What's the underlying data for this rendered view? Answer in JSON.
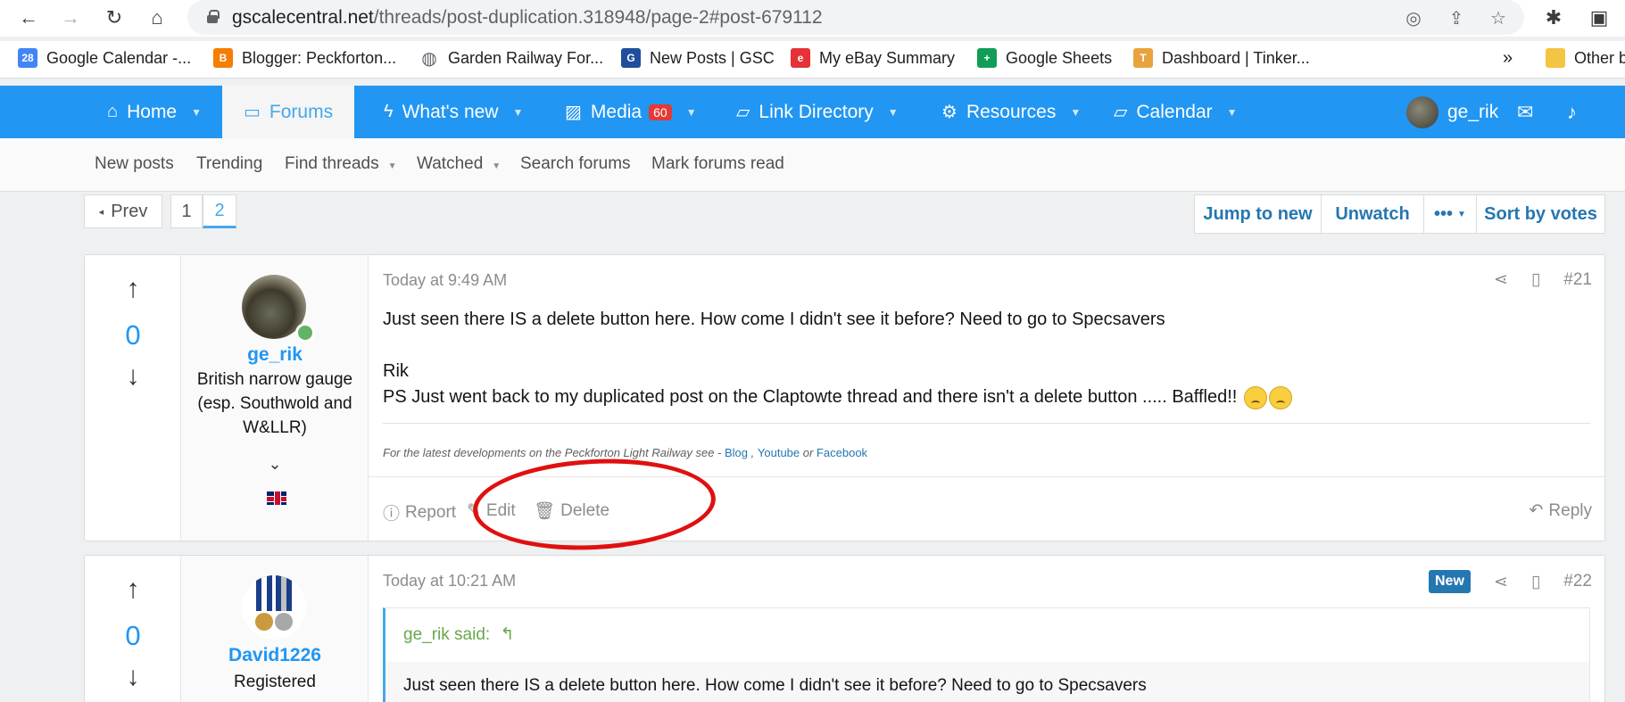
{
  "browser": {
    "url_host": "gscalecentral.net",
    "url_path": "/threads/post-duplication.318948/page-2#post-679112",
    "bookmarks": [
      {
        "label": "Google Calendar -...",
        "color": "#4285f4",
        "glyph": "28"
      },
      {
        "label": "Blogger: Peckforton...",
        "color": "#f57d00",
        "glyph": "B"
      },
      {
        "label": "Garden Railway For...",
        "color": "#5f6368",
        "glyph": "◍"
      },
      {
        "label": "New Posts | GSC",
        "color": "#1f4e9c",
        "glyph": "G"
      },
      {
        "label": "My eBay Summary",
        "color": "#e53238",
        "glyph": "e"
      },
      {
        "label": "Google Sheets",
        "color": "#0f9d58",
        "glyph": "+"
      },
      {
        "label": "Dashboard | Tinker...",
        "color": "#e8a33d",
        "glyph": "T"
      }
    ],
    "bookmarks_overflow": "»",
    "other_bookmarks": "Other b"
  },
  "nav": {
    "tabs": [
      {
        "label": "Home",
        "icon": "home-icon"
      },
      {
        "label": "Forums",
        "icon": "chat-icon"
      },
      {
        "label": "What's new",
        "icon": "bolt-icon"
      },
      {
        "label": "Media",
        "icon": "image-icon",
        "badge": "60"
      },
      {
        "label": "Link Directory",
        "icon": "folder-icon"
      },
      {
        "label": "Resources",
        "icon": "cogs-icon"
      },
      {
        "label": "Calendar",
        "icon": "folder-icon"
      }
    ],
    "user": "ge_rik"
  },
  "subnav": [
    "New posts",
    "Trending",
    "Find threads",
    "Watched",
    "Search forums",
    "Mark forums read"
  ],
  "pagination": {
    "prev": "Prev",
    "pages": [
      "1",
      "2"
    ],
    "current": "2"
  },
  "thread_actions": {
    "jump": "Jump to new",
    "unwatch": "Unwatch",
    "more": "•••",
    "sort": "Sort by votes"
  },
  "posts": [
    {
      "votes": "0",
      "username": "ge_rik",
      "user_title": "British narrow gauge (esp. Southwold and W&LLR)",
      "date": "Today at 9:49 AM",
      "number": "#21",
      "line1": "Just seen there IS a delete button here. How come I didn't see it before? Need to go to Specsavers",
      "line2": "Rik",
      "line3": "PS Just went back to my duplicated post on the Claptowte thread and there isn't a delete button ..... Baffled!!",
      "signature_prefix": "For the latest developments on the Peckforton Light Railway see -",
      "sig_links": [
        "Blog",
        "Youtube",
        "Facebook"
      ],
      "sig_sep1": ",",
      "sig_sep2": "or",
      "actions": {
        "report": "Report",
        "edit": "Edit",
        "delete": "Delete",
        "reply": "Reply"
      }
    },
    {
      "votes": "0",
      "username": "David1226",
      "user_title": "Registered",
      "date": "Today at 10:21 AM",
      "number": "#22",
      "badge": "New",
      "quote_author": "ge_rik said:",
      "quote_text": "Just seen there IS a delete button here. How come I didn't see it before? Need to go to Specsavers"
    }
  ]
}
